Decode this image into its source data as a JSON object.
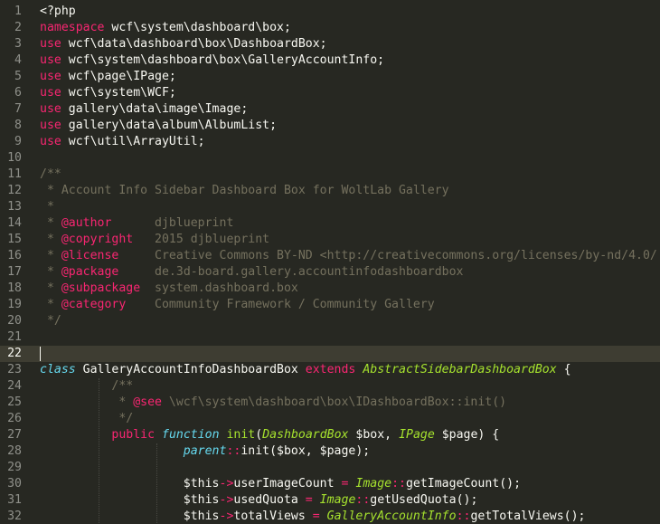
{
  "colors": {
    "background": "#272822",
    "active_line": "#3e3d32",
    "line_number": "#8f908a",
    "plain": "#f8f8f2",
    "keyword": "#f92672",
    "storage": "#66d9ef",
    "class_name": "#a6e22e",
    "comment": "#75715e"
  },
  "editor": {
    "active_line": 22,
    "lines": [
      {
        "num": "1",
        "tokens": [
          {
            "t": "<?php",
            "c": "plain"
          }
        ]
      },
      {
        "num": "2",
        "tokens": [
          {
            "t": "namespace",
            "c": "kw"
          },
          {
            "t": " wcf\\system\\dashboard\\box;",
            "c": "plain"
          }
        ]
      },
      {
        "num": "3",
        "tokens": [
          {
            "t": "use",
            "c": "kw"
          },
          {
            "t": " wcf\\data\\dashboard\\box\\DashboardBox;",
            "c": "plain"
          }
        ]
      },
      {
        "num": "4",
        "tokens": [
          {
            "t": "use",
            "c": "kw"
          },
          {
            "t": " wcf\\system\\dashboard\\box\\GalleryAccountInfo;",
            "c": "plain"
          }
        ]
      },
      {
        "num": "5",
        "tokens": [
          {
            "t": "use",
            "c": "kw"
          },
          {
            "t": " wcf\\page\\IPage;",
            "c": "plain"
          }
        ]
      },
      {
        "num": "6",
        "tokens": [
          {
            "t": "use",
            "c": "kw"
          },
          {
            "t": " wcf\\system\\WCF;",
            "c": "plain"
          }
        ]
      },
      {
        "num": "7",
        "tokens": [
          {
            "t": "use",
            "c": "kw"
          },
          {
            "t": " gallery\\data\\image\\Image;",
            "c": "plain"
          }
        ]
      },
      {
        "num": "8",
        "tokens": [
          {
            "t": "use",
            "c": "kw"
          },
          {
            "t": " gallery\\data\\album\\AlbumList;",
            "c": "plain"
          }
        ]
      },
      {
        "num": "9",
        "tokens": [
          {
            "t": "use",
            "c": "kw"
          },
          {
            "t": " wcf\\util\\ArrayUtil;",
            "c": "plain"
          }
        ]
      },
      {
        "num": "10",
        "tokens": []
      },
      {
        "num": "11",
        "tokens": [
          {
            "t": "/**",
            "c": "cmt"
          }
        ]
      },
      {
        "num": "12",
        "tokens": [
          {
            "t": " * Account Info Sidebar Dashboard Box for WoltLab Gallery",
            "c": "cmt"
          }
        ]
      },
      {
        "num": "13",
        "tokens": [
          {
            "t": " *",
            "c": "cmt"
          }
        ]
      },
      {
        "num": "14",
        "tokens": [
          {
            "t": " * ",
            "c": "cmt"
          },
          {
            "t": "@author",
            "c": "tag"
          },
          {
            "t": "      djblueprint",
            "c": "cmt"
          }
        ]
      },
      {
        "num": "15",
        "tokens": [
          {
            "t": " * ",
            "c": "cmt"
          },
          {
            "t": "@copyright",
            "c": "tag"
          },
          {
            "t": "   2015 djblueprint",
            "c": "cmt"
          }
        ]
      },
      {
        "num": "16",
        "tokens": [
          {
            "t": " * ",
            "c": "cmt"
          },
          {
            "t": "@license",
            "c": "tag"
          },
          {
            "t": "     Creative Commons BY-ND <http://creativecommons.org/licenses/by-nd/4.0/",
            "c": "cmt"
          }
        ]
      },
      {
        "num": "17",
        "tokens": [
          {
            "t": " * ",
            "c": "cmt"
          },
          {
            "t": "@package",
            "c": "tag"
          },
          {
            "t": "     de.3d-board.gallery.accountinfodashboardbox",
            "c": "cmt"
          }
        ]
      },
      {
        "num": "18",
        "tokens": [
          {
            "t": " * ",
            "c": "cmt"
          },
          {
            "t": "@subpackage",
            "c": "tag"
          },
          {
            "t": "  system.dashboard.box",
            "c": "cmt"
          }
        ]
      },
      {
        "num": "19",
        "tokens": [
          {
            "t": " * ",
            "c": "cmt"
          },
          {
            "t": "@category",
            "c": "tag"
          },
          {
            "t": "    Community Framework / Community Gallery",
            "c": "cmt"
          }
        ]
      },
      {
        "num": "20",
        "tokens": [
          {
            "t": " */",
            "c": "cmt"
          }
        ]
      },
      {
        "num": "21",
        "tokens": []
      },
      {
        "num": "22",
        "tokens": []
      },
      {
        "num": "23",
        "tokens": [
          {
            "t": "class",
            "c": "sto"
          },
          {
            "t": " GalleryAccountInfoDashboardBox ",
            "c": "plain"
          },
          {
            "t": "extends",
            "c": "kw"
          },
          {
            "t": " ",
            "c": "plain"
          },
          {
            "t": "AbstractSidebarDashboardBox",
            "c": "cls"
          },
          {
            "t": " {",
            "c": "plain"
          }
        ]
      },
      {
        "num": "24",
        "tokens": [
          {
            "t": "          /**",
            "c": "cmt"
          }
        ]
      },
      {
        "num": "25",
        "tokens": [
          {
            "t": "           * ",
            "c": "cmt"
          },
          {
            "t": "@see",
            "c": "tag"
          },
          {
            "t": " \\wcf\\system\\dashboard\\box\\IDashboardBox::init()",
            "c": "cmt"
          }
        ]
      },
      {
        "num": "26",
        "tokens": [
          {
            "t": "           */",
            "c": "cmt"
          }
        ]
      },
      {
        "num": "27",
        "tokens": [
          {
            "t": "          ",
            "c": "plain"
          },
          {
            "t": "public",
            "c": "kw"
          },
          {
            "t": " ",
            "c": "plain"
          },
          {
            "t": "function",
            "c": "sto"
          },
          {
            "t": " ",
            "c": "plain"
          },
          {
            "t": "init",
            "c": "fn"
          },
          {
            "t": "(",
            "c": "plain"
          },
          {
            "t": "DashboardBox",
            "c": "cls"
          },
          {
            "t": " $box, ",
            "c": "plain"
          },
          {
            "t": "IPage",
            "c": "cls"
          },
          {
            "t": " $page) {",
            "c": "plain"
          }
        ]
      },
      {
        "num": "28",
        "tokens": [
          {
            "t": "                    ",
            "c": "plain"
          },
          {
            "t": "parent",
            "c": "sto"
          },
          {
            "t": "::",
            "c": "op"
          },
          {
            "t": "init($box, $page);",
            "c": "plain"
          }
        ]
      },
      {
        "num": "29",
        "tokens": []
      },
      {
        "num": "30",
        "tokens": [
          {
            "t": "                    $this",
            "c": "plain"
          },
          {
            "t": "->",
            "c": "op"
          },
          {
            "t": "userImageCount ",
            "c": "plain"
          },
          {
            "t": "=",
            "c": "op"
          },
          {
            "t": " ",
            "c": "plain"
          },
          {
            "t": "Image",
            "c": "cls"
          },
          {
            "t": "::",
            "c": "op"
          },
          {
            "t": "getImageCount();",
            "c": "plain"
          }
        ]
      },
      {
        "num": "31",
        "tokens": [
          {
            "t": "                    $this",
            "c": "plain"
          },
          {
            "t": "->",
            "c": "op"
          },
          {
            "t": "usedQuota ",
            "c": "plain"
          },
          {
            "t": "=",
            "c": "op"
          },
          {
            "t": " ",
            "c": "plain"
          },
          {
            "t": "Image",
            "c": "cls"
          },
          {
            "t": "::",
            "c": "op"
          },
          {
            "t": "getUsedQuota();",
            "c": "plain"
          }
        ]
      },
      {
        "num": "32",
        "tokens": [
          {
            "t": "                    $this",
            "c": "plain"
          },
          {
            "t": "->",
            "c": "op"
          },
          {
            "t": "totalViews ",
            "c": "plain"
          },
          {
            "t": "=",
            "c": "op"
          },
          {
            "t": " ",
            "c": "plain"
          },
          {
            "t": "GalleryAccountInfo",
            "c": "cls"
          },
          {
            "t": "::",
            "c": "op"
          },
          {
            "t": "getTotalViews();",
            "c": "plain"
          }
        ]
      }
    ]
  }
}
